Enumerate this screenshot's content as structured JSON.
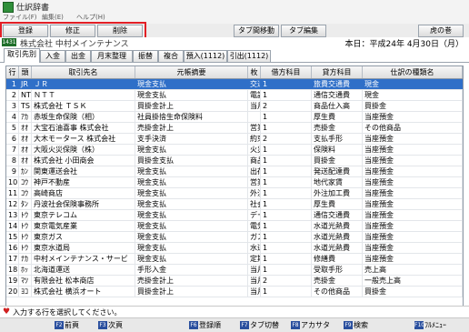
{
  "window": {
    "title": "仕訳辞書"
  },
  "menu": {
    "items": [
      "ファイル(F)",
      "編集(E)",
      "ヘルプ(H)"
    ]
  },
  "toolbar": {
    "buttons": [
      "登録",
      "修正",
      "削除",
      "タブ間移動",
      "タブ編集",
      "虎の巻"
    ]
  },
  "info": {
    "badge": "1431",
    "company": "株式会社 中村メインテナンス",
    "date": "本日：平成24年 4月30日（月）"
  },
  "tabs": [
    "取引先別",
    "入金",
    "出金",
    "月末整理",
    "振替",
    "複合",
    "預入(1112)",
    "引出(1112)"
  ],
  "grid": {
    "headers": [
      "行",
      "頭",
      "取引先名",
      "元帳摘要",
      "枚",
      "借方科目",
      "貸方科目",
      "仕訳の種類名"
    ],
    "rows": [
      [
        "1",
        "JR",
        "ＪＲ",
        "現金支払",
        "交通費",
        "1",
        "旅費交通費",
        "現金"
      ],
      [
        "2",
        "NT",
        "ＮＴＴ",
        "現金支払",
        "電話代",
        "1",
        "通信交通費",
        "現金"
      ],
      [
        "3",
        "TS",
        "株式会社 ＴＳＫ",
        "買掛金計上",
        "当月仕入高",
        "2",
        "商品仕入高",
        "買掛金"
      ],
      [
        "4",
        "ｱｶ",
        "赤坂生命保険（相）",
        "社員掛捨生命保険料",
        "",
        "1",
        "厚生費",
        "当座預金"
      ],
      [
        "5",
        "ｵｵ",
        "大宝石油喜事 株式会社",
        "売掛金計上",
        "営業収入",
        "1",
        "売掛金",
        "その他商品"
      ],
      [
        "6",
        "ｵｵ",
        "大木モータース 株式会社",
        "支手決済",
        "約束手形",
        "2",
        "支払手形",
        "当座預金"
      ],
      [
        "7",
        "ｵｵ",
        "大阪火災保険（株）",
        "現金支払",
        "火災保険料",
        "1",
        "保険料",
        "当座預金"
      ],
      [
        "8",
        "ｵｵ",
        "株式会社 小田商会",
        "買掛金支払",
        "商品仕入高",
        "1",
        "買掛金",
        "当座預金"
      ],
      [
        "9",
        "ｶﾝ",
        "関東運送会社",
        "現金支払",
        "出荷運賃",
        "1",
        "発送配達費",
        "当座預金"
      ],
      [
        "10",
        "ｺｳ",
        "神戸不動産",
        "現金支払",
        "営業所家賃",
        "1",
        "地代家賃",
        "当座預金"
      ],
      [
        "11",
        "ｺｳ",
        "高崎商店",
        "現金支払",
        "外注加工費",
        "1",
        "外注加工費",
        "当座預金"
      ],
      [
        "12",
        "ﾀﾝ",
        "丹波社会保険事務所",
        "現金支払",
        "社会保険料",
        "1",
        "厚生費",
        "当座預金"
      ],
      [
        "13",
        "ﾄｳ",
        "東京テレコム",
        "現金支払",
        "データ通信費",
        "1",
        "通信交通費",
        "当座預金"
      ],
      [
        "14",
        "ﾄｳ",
        "東京電気産業",
        "現金支払",
        "電気代",
        "1",
        "水道光熱費",
        "当座預金"
      ],
      [
        "15",
        "ﾄｳ",
        "東京ガス",
        "現金支払",
        "ガス代",
        "1",
        "水道光熱費",
        "当座預金"
      ],
      [
        "16",
        "ﾄｳ",
        "東京水道局",
        "現金支払",
        "水道料",
        "1",
        "水道光熱費",
        "当座預金"
      ],
      [
        "17",
        "ﾅｶ",
        "中村メインテナンス・サービ",
        "現金支払",
        "定期保守料",
        "1",
        "修繕費",
        "当座預金"
      ],
      [
        "18",
        "ﾎｯ",
        "北海道運送",
        "手形入金",
        "当月売上高",
        "1",
        "受取手形",
        "売上高"
      ],
      [
        "19",
        "ﾏﾂ",
        "有限会社 松本商店",
        "売掛金計上",
        "当月売上高",
        "2",
        "売掛金",
        "一般売上高"
      ],
      [
        "20",
        "ﾖｺ",
        "株式会社 横浜オート",
        "買掛金計上",
        "当月仕入高",
        "1",
        "その他商品",
        "買掛金"
      ]
    ]
  },
  "status": {
    "message": "入力する行を選択してください。"
  },
  "fkeys": [
    {
      "key": "F2",
      "label": "前頁"
    },
    {
      "key": "F3",
      "label": "次頁"
    },
    {
      "key": "F6",
      "label": "登録順"
    },
    {
      "key": "F7",
      "label": "タブ切替"
    },
    {
      "key": "F8",
      "label": "アカサタ"
    },
    {
      "key": "F9",
      "label": "検索"
    },
    {
      "key": "F10",
      "label": "ﾌﾙﾒﾆｭｰ"
    }
  ]
}
